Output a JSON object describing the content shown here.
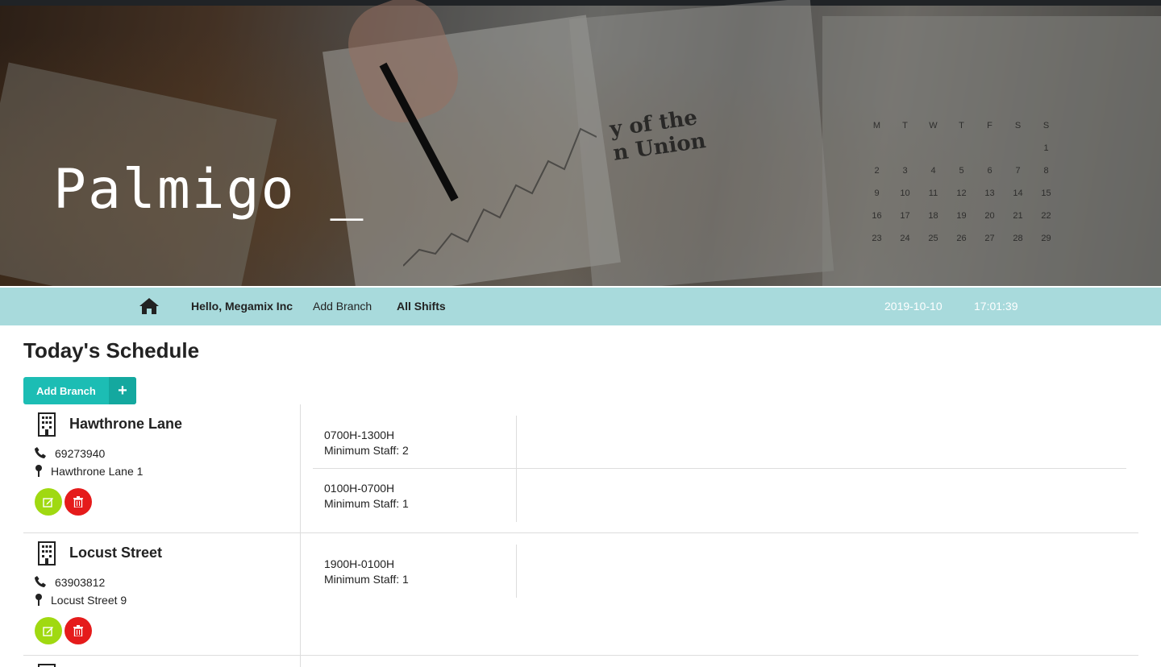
{
  "brand": {
    "title": "Palmigo _"
  },
  "nav": {
    "greeting": "Hello, Megamix Inc",
    "add_branch": "Add Branch",
    "all_shifts": "All Shifts",
    "date": "2019-10-10",
    "time": "17:01:39"
  },
  "main": {
    "title": "Today's Schedule",
    "add_button": "Add Branch"
  },
  "branches": [
    {
      "name": "Hawthrone Lane",
      "phone": "69273940",
      "address": "Hawthrone Lane 1",
      "shifts": [
        {
          "time": "0700H-1300H",
          "min_staff": "Minimum Staff: 2"
        },
        {
          "time": "0100H-0700H",
          "min_staff": "Minimum Staff: 1"
        }
      ]
    },
    {
      "name": "Locust Street",
      "phone": "63903812",
      "address": "Locust Street 9",
      "shifts": [
        {
          "time": "1900H-0100H",
          "min_staff": "Minimum Staff: 1"
        }
      ]
    }
  ],
  "colors": {
    "navbar": "#a8dadc",
    "primary_button": "#1cbdb4",
    "edit_button": "#a0d911",
    "delete_button": "#e51b1b"
  },
  "icons": [
    "home-icon",
    "building-icon",
    "phone-icon",
    "map-pin-icon",
    "edit-icon",
    "trash-icon",
    "plus-icon"
  ]
}
